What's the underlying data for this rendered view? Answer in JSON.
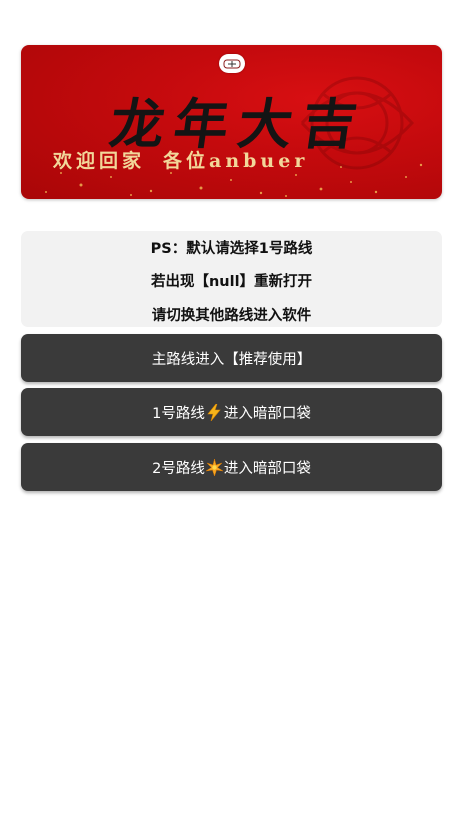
{
  "banner": {
    "title": "龙年大吉",
    "subtitle_left": "欢迎回家",
    "subtitle_right": "各位anbuer",
    "logo_icon": "app-logo-icon",
    "background_color": "#c40a0d"
  },
  "notice": {
    "line1": "PS：默认请选择1号路线",
    "line2": "若出现【null】重新打开",
    "line3": "请切换其他路线进入软件"
  },
  "buttons": {
    "main_route": "主路线进入【推荐使用】",
    "route1_prefix": "1号路线",
    "route1_icon": "lightning-icon",
    "route1_suffix": "进入暗部口袋",
    "route2_prefix": "2号路线",
    "route2_icon": "sparkle-burst-icon",
    "route2_suffix": "进入暗部口袋"
  },
  "colors": {
    "button_bg": "#3a3a3a",
    "notice_bg": "#f2f2f2",
    "subtitle": "#f2d79a"
  }
}
